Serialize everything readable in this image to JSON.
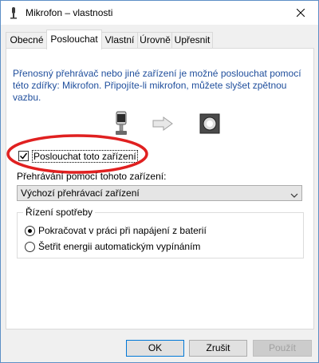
{
  "window": {
    "title": "Mikrofon – vlastnosti"
  },
  "tabs": [
    {
      "label": "Obecné"
    },
    {
      "label": "Poslouchat"
    },
    {
      "label": "Vlastní"
    },
    {
      "label": "Úrovně"
    },
    {
      "label": "Upřesnit"
    }
  ],
  "active_tab": "Poslouchat",
  "description": "Přenosný přehrávač nebo jiné zařízení je možné poslouchat pomocí této zdířky: Mikrofon. Připojíte-li mikrofon, můžete slyšet zpětnou vazbu.",
  "icons": [
    "microphone-icon",
    "arrow-right-icon",
    "speaker-icon",
    "close-icon"
  ],
  "listen": {
    "label": "Poslouchat toto zařízení",
    "checked": true
  },
  "playback": {
    "label": "Přehrávání pomocí tohoto zařízení:",
    "selected": "Výchozí přehrávací zařízení"
  },
  "power": {
    "title": "Řízení spotřeby",
    "options": [
      {
        "label": "Pokračovat v práci při napájení z baterií",
        "checked": true
      },
      {
        "label": "Šetřit energii automatickým vypínáním",
        "checked": false
      }
    ]
  },
  "buttons": {
    "ok": "OK",
    "cancel": "Zrušit",
    "apply": "Použít"
  },
  "colors": {
    "highlight_ellipse": "#e02020",
    "link_text": "#1f4e9c",
    "accent": "#0078d7"
  }
}
